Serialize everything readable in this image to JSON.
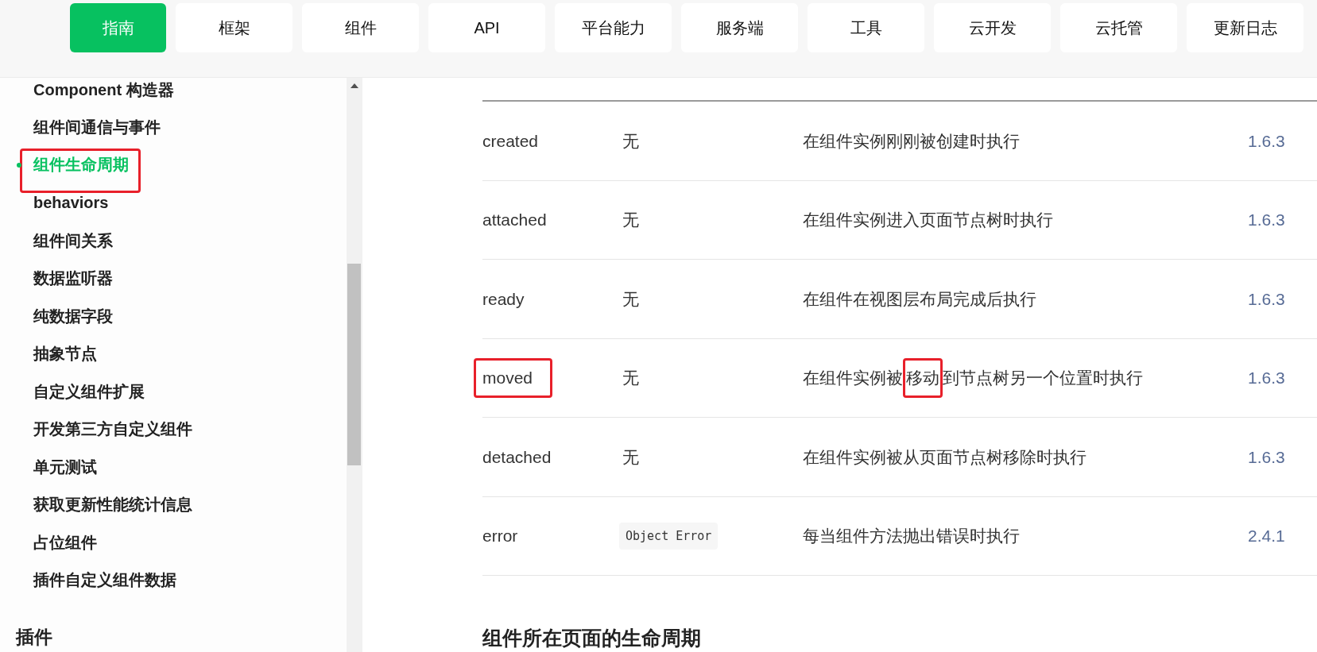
{
  "nav": [
    {
      "label": "指南",
      "selected": true
    },
    {
      "label": "框架",
      "selected": false
    },
    {
      "label": "组件",
      "selected": false
    },
    {
      "label": "API",
      "selected": false
    },
    {
      "label": "平台能力",
      "selected": false
    },
    {
      "label": "服务端",
      "selected": false
    },
    {
      "label": "工具",
      "selected": false
    },
    {
      "label": "云开发",
      "selected": false
    },
    {
      "label": "云托管",
      "selected": false
    },
    {
      "label": "更新日志",
      "selected": false
    }
  ],
  "sidebar": {
    "items": [
      {
        "label": "Component 构造器",
        "selected": false,
        "highlighted": false
      },
      {
        "label": "组件间通信与事件",
        "selected": false,
        "highlighted": false
      },
      {
        "label": "组件生命周期",
        "selected": true,
        "highlighted": true
      },
      {
        "label": "behaviors",
        "selected": false,
        "highlighted": false
      },
      {
        "label": "组件间关系",
        "selected": false,
        "highlighted": false
      },
      {
        "label": "数据监听器",
        "selected": false,
        "highlighted": false
      },
      {
        "label": "纯数据字段",
        "selected": false,
        "highlighted": false
      },
      {
        "label": "抽象节点",
        "selected": false,
        "highlighted": false
      },
      {
        "label": "自定义组件扩展",
        "selected": false,
        "highlighted": false
      },
      {
        "label": "开发第三方自定义组件",
        "selected": false,
        "highlighted": false
      },
      {
        "label": "单元测试",
        "selected": false,
        "highlighted": false
      },
      {
        "label": "获取更新性能统计信息",
        "selected": false,
        "highlighted": false
      },
      {
        "label": "占位组件",
        "selected": false,
        "highlighted": false
      },
      {
        "label": "插件自定义组件数据",
        "selected": false,
        "highlighted": false
      }
    ],
    "section": "插件"
  },
  "table": {
    "rows": [
      {
        "name": "created",
        "name_highlighted": false,
        "param": "无",
        "kind": "text",
        "desc": [
          {
            "text": "在组件实例刚刚被创建时执行",
            "highlighted": false
          }
        ],
        "version": "1.6.3"
      },
      {
        "name": "attached",
        "name_highlighted": false,
        "param": "无",
        "kind": "text",
        "desc": [
          {
            "text": "在组件实例进入页面节点树时执行",
            "highlighted": false
          }
        ],
        "version": "1.6.3"
      },
      {
        "name": "ready",
        "name_highlighted": false,
        "param": "无",
        "kind": "text",
        "desc": [
          {
            "text": "在组件在视图层布局完成后执行",
            "highlighted": false
          }
        ],
        "version": "1.6.3"
      },
      {
        "name": "moved",
        "name_highlighted": true,
        "param": "无",
        "kind": "text",
        "desc": [
          {
            "text": "在组件实例被",
            "highlighted": false
          },
          {
            "text": "移动",
            "highlighted": true
          },
          {
            "text": "到节点树另一个位置时执行",
            "highlighted": false
          }
        ],
        "version": "1.6.3"
      },
      {
        "name": "detached",
        "name_highlighted": false,
        "param": "无",
        "kind": "text",
        "desc": [
          {
            "text": "在组件实例被从页面节点树移除时执行",
            "highlighted": false
          }
        ],
        "version": "1.6.3"
      },
      {
        "name": "error",
        "name_highlighted": false,
        "param": "Object Error",
        "kind": "code",
        "desc": [
          {
            "text": "每当组件方法抛出错误时执行",
            "highlighted": false
          }
        ],
        "version": "2.4.1"
      }
    ]
  },
  "heading": "组件所在页面的生命周期"
}
